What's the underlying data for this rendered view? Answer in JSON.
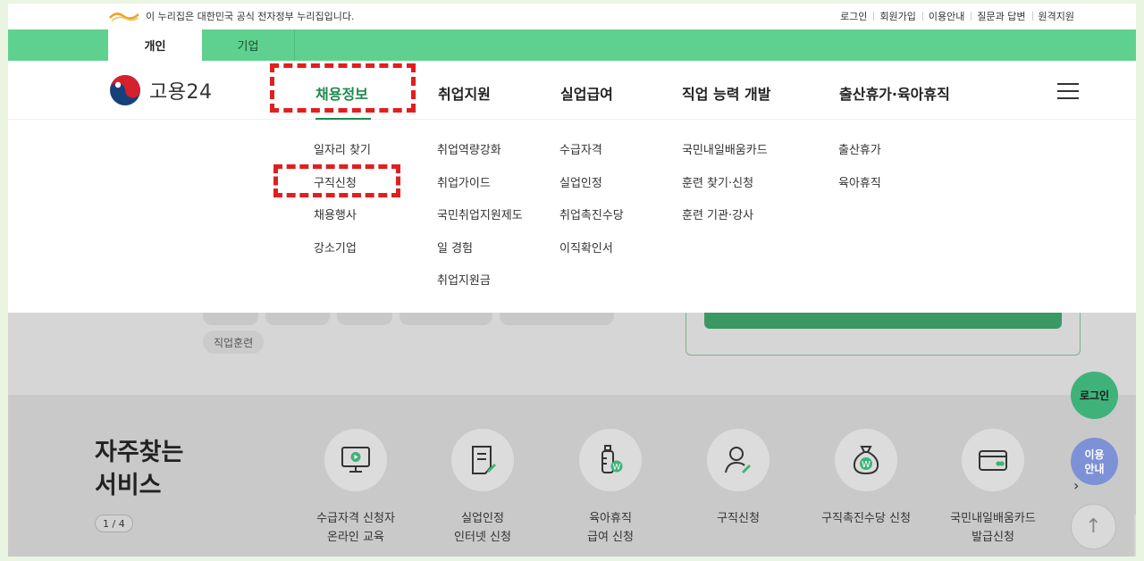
{
  "utility_bar": {
    "notice": "이 누리집은 대한민국 공식 전자정부 누리집입니다.",
    "links": [
      "로그인",
      "회원가입",
      "이용안내",
      "질문과 답변",
      "원격지원"
    ]
  },
  "audience_tabs": [
    "개인",
    "기업"
  ],
  "header": {
    "logo_text": "고용24",
    "gnb": [
      "채용정보",
      "취업지원",
      "실업급여",
      "직업 능력 개발",
      "출산휴가·육아휴직"
    ]
  },
  "dropdown": {
    "columns": [
      [
        "일자리 찾기",
        "구직신청",
        "채용행사",
        "강소기업"
      ],
      [
        "취업역량강화",
        "취업가이드",
        "국민취업지원제도",
        "일 경험",
        "취업지원금"
      ],
      [
        "수급자격",
        "실업인정",
        "취업촉진수당",
        "이직확인서"
      ],
      [
        "국민내일배움카드",
        "훈련 찾기·신청",
        "훈련 기관·강사"
      ],
      [
        "출산휴가",
        "육아휴직"
      ]
    ]
  },
  "background_page": {
    "chip": "직업훈련",
    "frequent_services": {
      "title_line1": "자주찾는",
      "title_line2": "서비스",
      "pager": "1 / 4",
      "items": [
        {
          "label": "수급자격 신청자\n온라인 교육",
          "icon": "monitor-play-icon"
        },
        {
          "label": "실업인정\n인터넷 신청",
          "icon": "document-pen-icon"
        },
        {
          "label": "육아휴직\n급여 신청",
          "icon": "baby-bottle-won-icon"
        },
        {
          "label": "구직신청",
          "icon": "person-pen-icon"
        },
        {
          "label": "구직촉진수당 신청",
          "icon": "money-bag-won-icon"
        },
        {
          "label": "국민내일배움카드\n발급신청",
          "icon": "card-icon"
        }
      ]
    }
  },
  "floating": {
    "login": "로그인",
    "guide": "이용\n안내",
    "top": "↑"
  },
  "colors": {
    "brand_green": "#5fd18e",
    "active_green": "#1f8a4c",
    "highlight_red": "#e01f1f"
  }
}
